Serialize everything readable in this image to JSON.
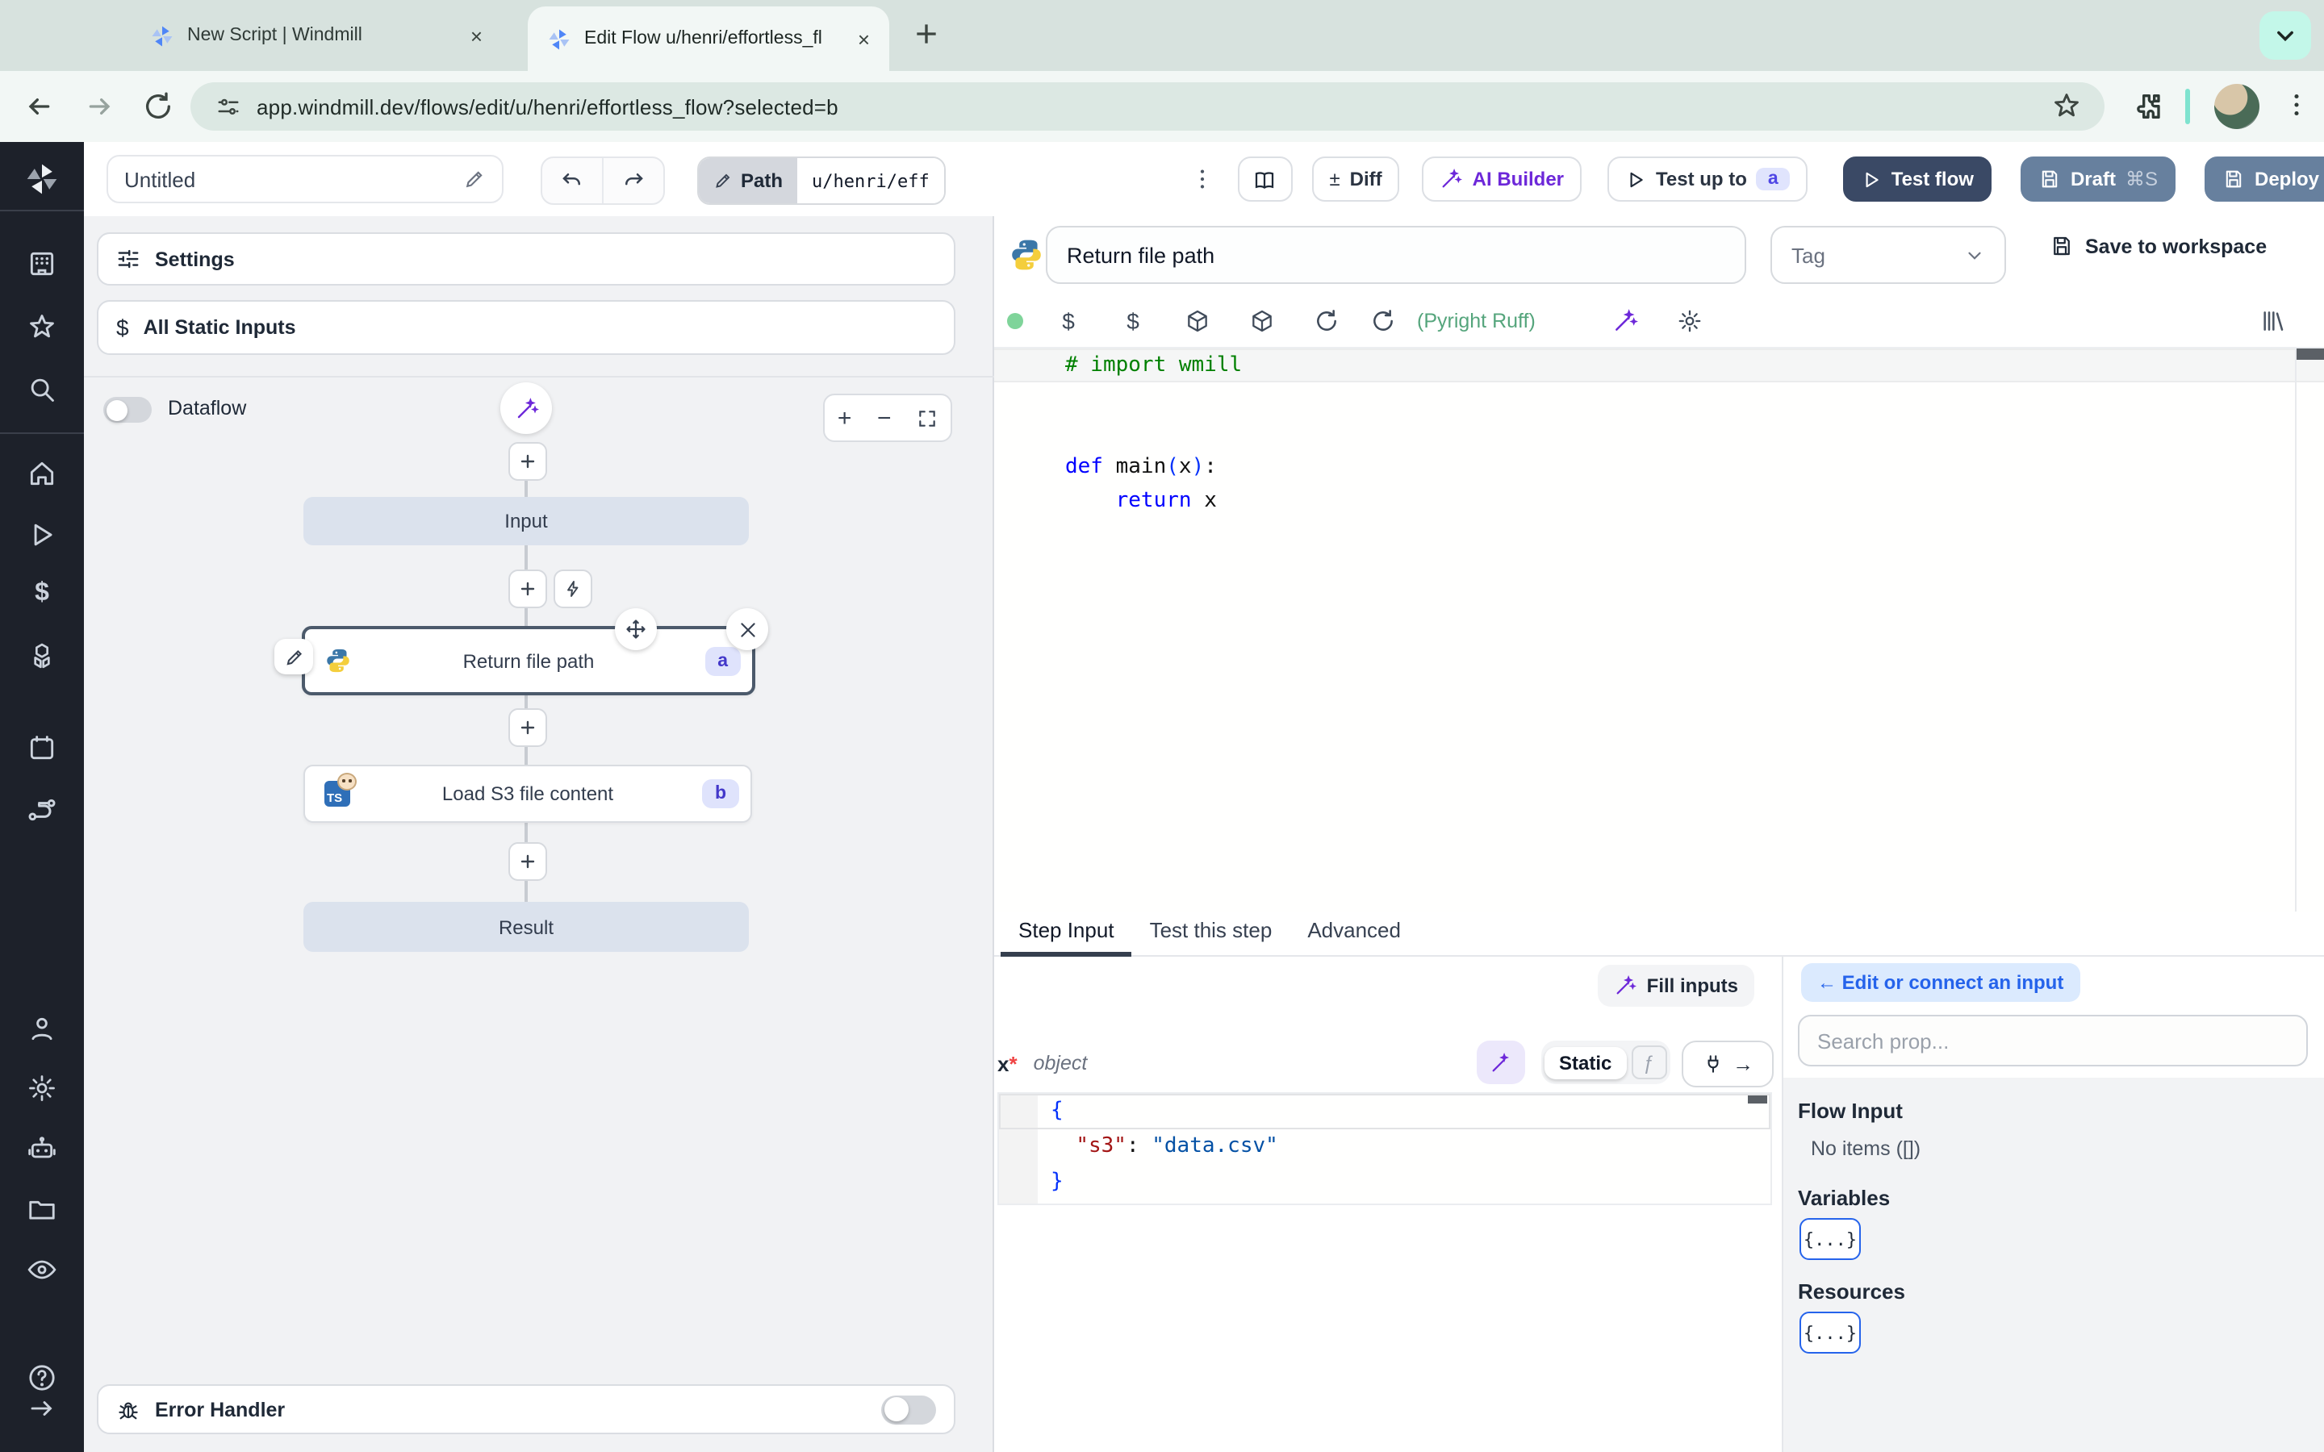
{
  "browser": {
    "tab1_title": "New Script | Windmill",
    "tab2_title": "Edit Flow u/henri/effortless_fl",
    "url": "app.windmill.dev/flows/edit/u/henri/effortless_flow?selected=b"
  },
  "app_header": {
    "flow_name": "Untitled",
    "path_label": "Path",
    "path_value": "u/henri/eff",
    "plus_minus": "±",
    "diff_label": "Diff",
    "ai_builder_label": "AI Builder",
    "test_up_to_label": "Test up to",
    "test_up_to_badge": "a",
    "test_flow_label": "Test flow",
    "draft_label": "Draft",
    "draft_shortcut": "⌘S",
    "deploy_label": "Deploy"
  },
  "flow_panel": {
    "settings_label": "Settings",
    "all_static_inputs_label": "All Static Inputs",
    "dataflow_label": "Dataflow",
    "input_node_label": "Input",
    "step_a_label": "Return file path",
    "step_a_badge": "a",
    "step_b_label": "Load S3 file content",
    "step_b_icon_text": "TS",
    "step_b_badge": "b",
    "result_node_label": "Result",
    "error_handler_label": "Error Handler"
  },
  "step_editor": {
    "name_value": "Return file path",
    "tag_label": "Tag",
    "save_label": "Save to workspace",
    "lint_status": "(Pyright Ruff)",
    "code_lines": [
      {
        "tokens": [
          {
            "t": "# import wmill",
            "c": "comment"
          }
        ],
        "current": true
      },
      {
        "tokens": []
      },
      {
        "tokens": []
      },
      {
        "tokens": [
          {
            "t": "def",
            "c": "kw"
          },
          {
            "t": " main",
            "c": "plain"
          },
          {
            "t": "(",
            "c": "paren"
          },
          {
            "t": "x",
            "c": "plain"
          },
          {
            "t": ")",
            "c": "paren"
          },
          {
            "t": ":",
            "c": "plain"
          }
        ]
      },
      {
        "tokens": [
          {
            "t": "    ",
            "c": "plain"
          },
          {
            "t": "return",
            "c": "kw"
          },
          {
            "t": " x",
            "c": "plain"
          }
        ]
      }
    ]
  },
  "bottom_panel": {
    "tab_step_input": "Step Input",
    "tab_test_step": "Test this step",
    "tab_advanced": "Advanced",
    "fill_inputs_label": "Fill inputs",
    "arg_name": "x",
    "required_mark": "*",
    "arg_type": "object",
    "static_label": "Static",
    "json_lines": [
      {
        "tokens": [
          {
            "t": "{",
            "c": "brace"
          }
        ],
        "current": true
      },
      {
        "tokens": [
          {
            "t": "  ",
            "c": "plain"
          },
          {
            "t": "\"s3\"",
            "c": "key"
          },
          {
            "t": ": ",
            "c": "plain"
          },
          {
            "t": "\"data.csv\"",
            "c": "str"
          }
        ]
      },
      {
        "tokens": [
          {
            "t": "}",
            "c": "brace"
          }
        ]
      }
    ]
  },
  "connect_panel": {
    "back_button_label": "← Edit or connect an input",
    "search_placeholder": "Search prop...",
    "flow_input_title": "Flow Input",
    "flow_input_empty": "No items ([])",
    "variables_title": "Variables",
    "resources_title": "Resources",
    "object_chip": "{...}"
  },
  "glyphs": {
    "dollar": "$",
    "plus": "+",
    "minus": "−",
    "fx": "ƒ",
    "arrow_right": "→",
    "close": "×"
  },
  "colors": {
    "accent_purple": "#6d28d9",
    "accent_blue": "#2563eb",
    "lint_green": "#55a57c",
    "test_flow_bg": "#3a4965",
    "deploy_bg": "#67809e",
    "selected_node_border": "#4c5a6b"
  }
}
